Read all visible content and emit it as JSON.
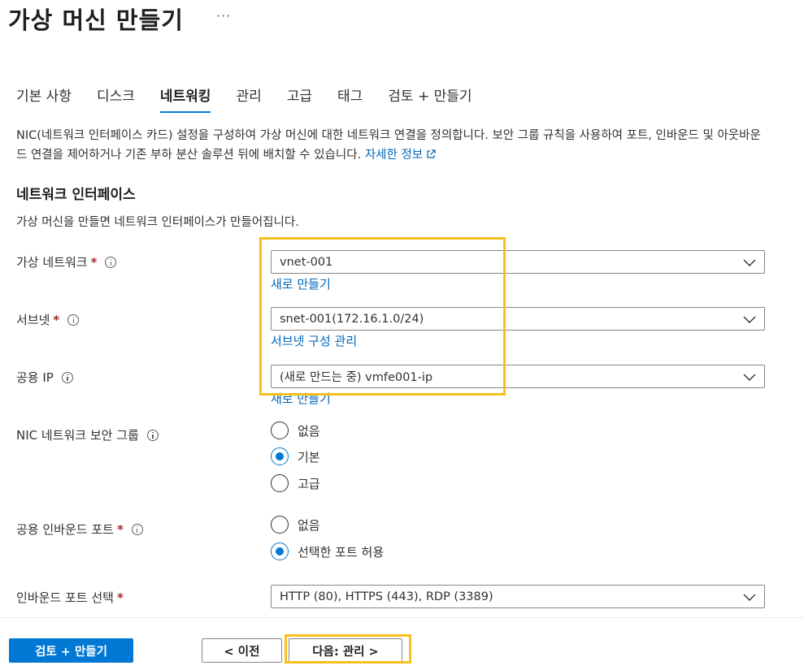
{
  "page": {
    "title": "가상 머신 만들기",
    "more_label": "···"
  },
  "tabs": [
    {
      "label": "기본 사항",
      "active": false
    },
    {
      "label": "디스크",
      "active": false
    },
    {
      "label": "네트워킹",
      "active": true
    },
    {
      "label": "관리",
      "active": false
    },
    {
      "label": "고급",
      "active": false
    },
    {
      "label": "태그",
      "active": false
    },
    {
      "label": "검토 + 만들기",
      "active": false
    }
  ],
  "description": {
    "text": "NIC(네트워크 인터페이스 카드) 설정을 구성하여 가상 머신에 대한 네트워크 연결을 정의합니다. 보안 그룹 규칙을 사용하여 포트, 인바운드 및 아웃바운드 연결을 제어하거나 기존 부하 분산 솔루션 뒤에 배치할 수 있습니다. ",
    "link": "자세한 정보"
  },
  "section": {
    "title": "네트워크 인터페이스",
    "description": "가상 머신을 만들면 네트워크 인터페이스가 만들어집니다."
  },
  "fields": {
    "vnet": {
      "label": "가상 네트워크",
      "value": "vnet-001",
      "link": "새로 만들기"
    },
    "subnet": {
      "label": "서브넷",
      "value": "snet-001(172.16.1.0/24)",
      "link": "서브넷 구성 관리"
    },
    "public_ip": {
      "label": "공용 IP",
      "value": "(새로 만드는 중) vmfe001-ip",
      "link": "새로 만들기"
    },
    "nsg": {
      "label": "NIC 네트워크 보안 그룹",
      "options": [
        {
          "label": "없음",
          "checked": false
        },
        {
          "label": "기본",
          "checked": true
        },
        {
          "label": "고급",
          "checked": false
        }
      ]
    },
    "inbound_ports": {
      "label": "공용 인바운드 포트",
      "options": [
        {
          "label": "없음",
          "checked": false
        },
        {
          "label": "선택한 포트 허용",
          "checked": true
        }
      ]
    },
    "select_ports": {
      "label": "인바운드 포트 선택",
      "value": "HTTP (80), HTTPS (443), RDP (3389)"
    }
  },
  "footer": {
    "review_create": "검토 + 만들기",
    "previous": "< 이전",
    "next": "다음: 관리 >"
  },
  "colors": {
    "accent": "#0078d4",
    "link": "#0066b8",
    "highlight": "#f8c01c",
    "required": "#a4262c"
  }
}
